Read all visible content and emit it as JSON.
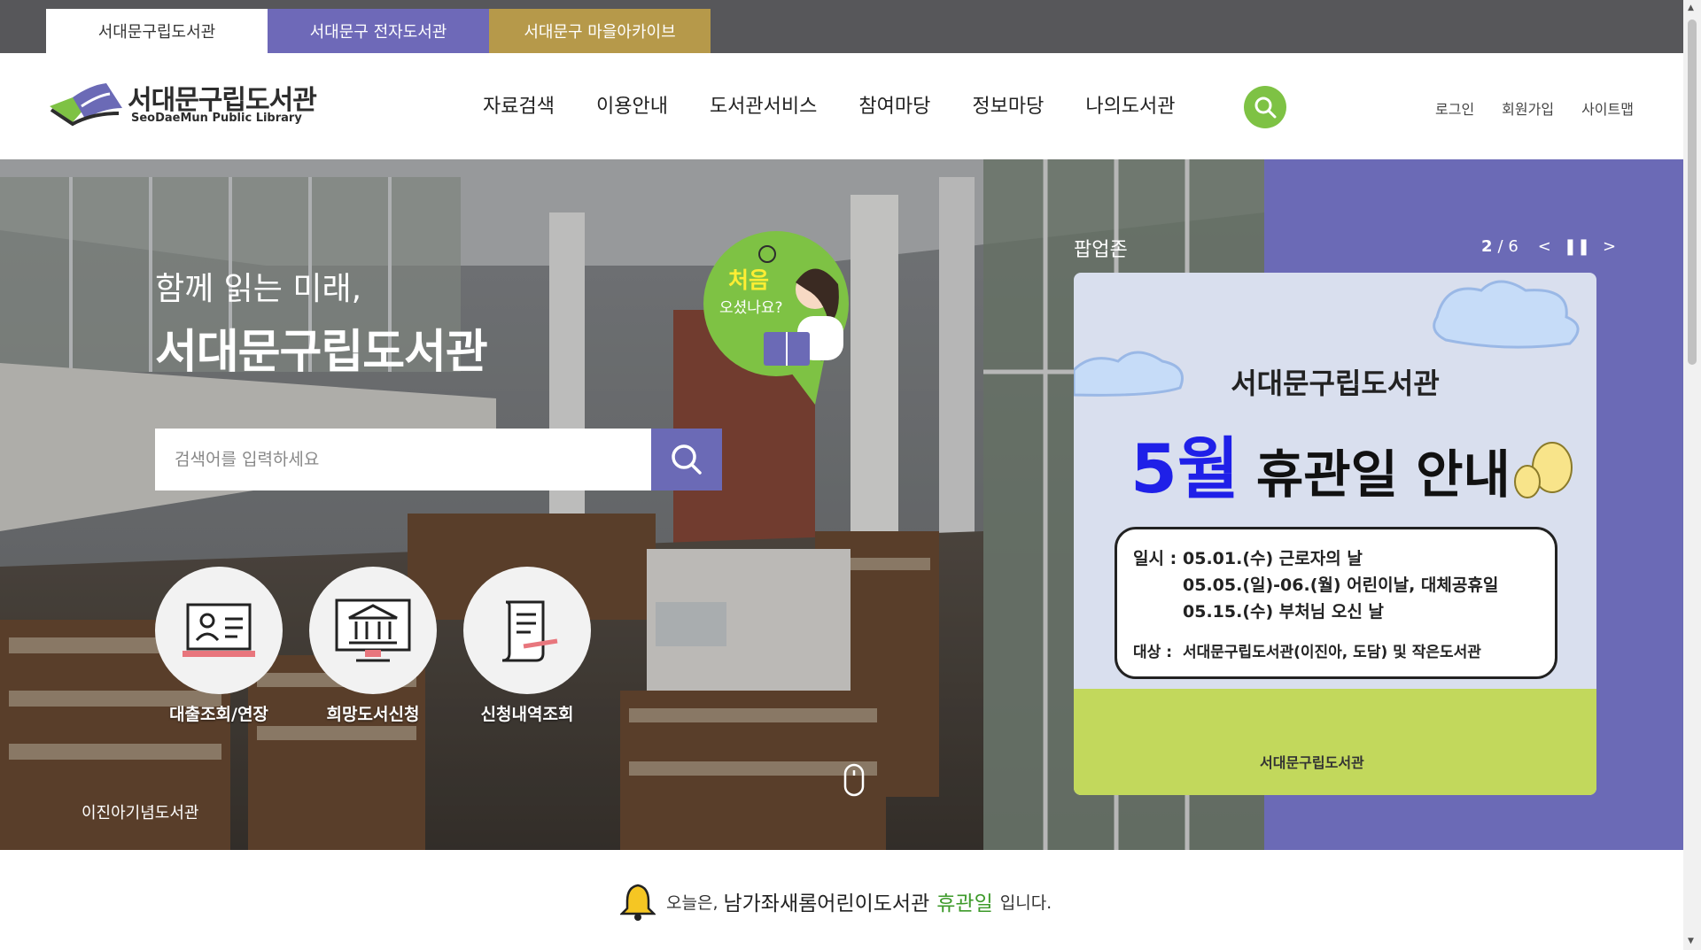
{
  "top_tabs": {
    "main": "서대문구립도서관",
    "ebook": "서대문구 전자도서관",
    "archive": "서대문구 마을아카이브"
  },
  "logo": {
    "name": "서대문구립도서관",
    "sub": "SeoDaeMun Public Library"
  },
  "gnb": [
    "자료검색",
    "이용안내",
    "도서관서비스",
    "참여마당",
    "정보마당",
    "나의도서관"
  ],
  "util": [
    "로그인",
    "회원가입",
    "사이트맵"
  ],
  "hero": {
    "tagline": "함께 읽는 미래,",
    "title": "서대문구립도서관",
    "search_placeholder": "검색어를 입력하세요",
    "first_visit_1": "처음",
    "first_visit_2": "오셨나요?",
    "quick": [
      "대출조회/연장",
      "희망도서신청",
      "신청내역조회"
    ],
    "location": "이진아기념도서관"
  },
  "popup": {
    "title": "팝업존",
    "current": "2",
    "total": "/ 6",
    "card_library": "서대문구립도서관",
    "card_month": "5월",
    "card_headline": "휴관일 안내",
    "date_label": "일시 :",
    "dates": [
      "05.01.(수) 근로자의 날",
      "05.05.(일)-06.(월) 어린이날, 대체공휴일",
      "05.15.(수) 부처님 오신 날"
    ],
    "target_label": "대상 :",
    "target": "서대문구립도서관(이진아, 도담) 및 작은도서관",
    "card_logo": "서대문구립도서관"
  },
  "notice": {
    "prefix": "오늘은,",
    "library": "남가좌새롬어린이도서관",
    "status": "휴관일",
    "suffix": "입니다."
  },
  "colors": {
    "accent_purple": "#6b6ab6",
    "accent_gold": "#b6994a",
    "accent_green": "#7ec244",
    "topbar": "#57575a"
  }
}
